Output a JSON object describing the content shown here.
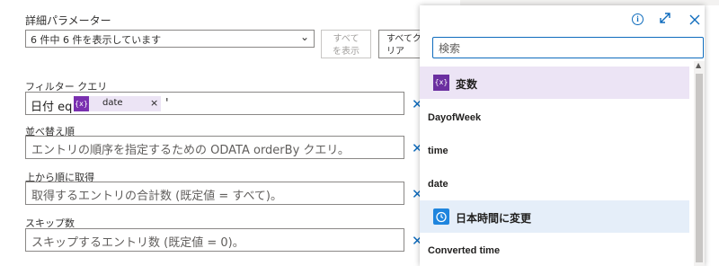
{
  "advanced": {
    "title": "詳細パラメーター",
    "dropdown_value": "6 件中 6 件を表示しています",
    "show_all_label": "すべてを表示",
    "clear_all_label": "すべてクリア"
  },
  "filter": {
    "label": "フィルター クエリ",
    "prefix": "日付 eq '",
    "token_icon": "{x}",
    "token_label": "date",
    "token_remove": "×",
    "suffix": "'"
  },
  "orderby": {
    "label": "並べ替え順",
    "placeholder": "エントリの順序を指定するための ODATA orderBy クエリ。"
  },
  "top": {
    "label": "上から順に取得",
    "placeholder": "取得するエントリの合計数 (既定値 = すべて)。"
  },
  "skip": {
    "label": "スキップ数",
    "placeholder": "スキップするエントリ数 (既定値 = 0)。"
  },
  "remove_glyph": "✕",
  "panel": {
    "search_placeholder": "検索",
    "info_icon": "info-icon",
    "expand_icon": "expand-icon",
    "close_icon": "close-icon",
    "sections": [
      {
        "type": "header",
        "icon": "{x}",
        "label": "変数",
        "color": "#6b2fa0",
        "bg": "#ece4f5"
      },
      {
        "type": "item",
        "label": "DayofWeek"
      },
      {
        "type": "item",
        "label": "time"
      },
      {
        "type": "item",
        "label": "date"
      },
      {
        "type": "header",
        "icon": "clock-icon",
        "label": "日本時間に変更",
        "color": "#1f85de",
        "bg": "#e5eef9"
      },
      {
        "type": "item",
        "label": "Converted time"
      }
    ]
  }
}
